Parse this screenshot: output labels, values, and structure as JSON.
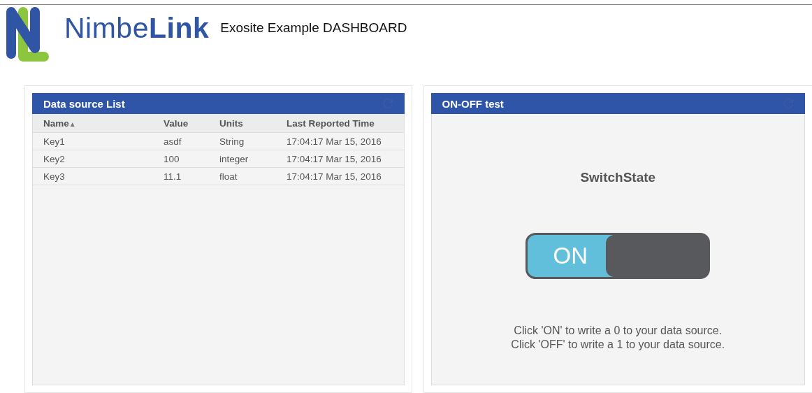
{
  "header": {
    "logo_text": "Nimbe**Link**",
    "title": "Exosite Example DASHBOARD"
  },
  "data_source_panel": {
    "title": "Data source List",
    "columns": [
      {
        "label": "Name",
        "sort_indicator": "▲"
      },
      {
        "label": "Value"
      },
      {
        "label": "Units"
      },
      {
        "label": "Last Reported Time"
      }
    ],
    "rows": [
      [
        "Key1",
        "asdf",
        "String",
        "17:04:17 Mar 15, 2016"
      ],
      [
        "Key2",
        "100",
        "integer",
        "17:04:17 Mar 15, 2016"
      ],
      [
        "Key3",
        "11.1",
        "float",
        "17:04:17 Mar 15, 2016"
      ]
    ]
  },
  "switch_panel": {
    "title": "ON-OFF test",
    "label": "SwitchState",
    "switch": {
      "on": true,
      "on_label": "ON"
    },
    "help_lines": [
      "Click 'ON' to write a 0 to your data source.",
      "Click 'OFF' to write a 1 to your data source."
    ]
  }
}
